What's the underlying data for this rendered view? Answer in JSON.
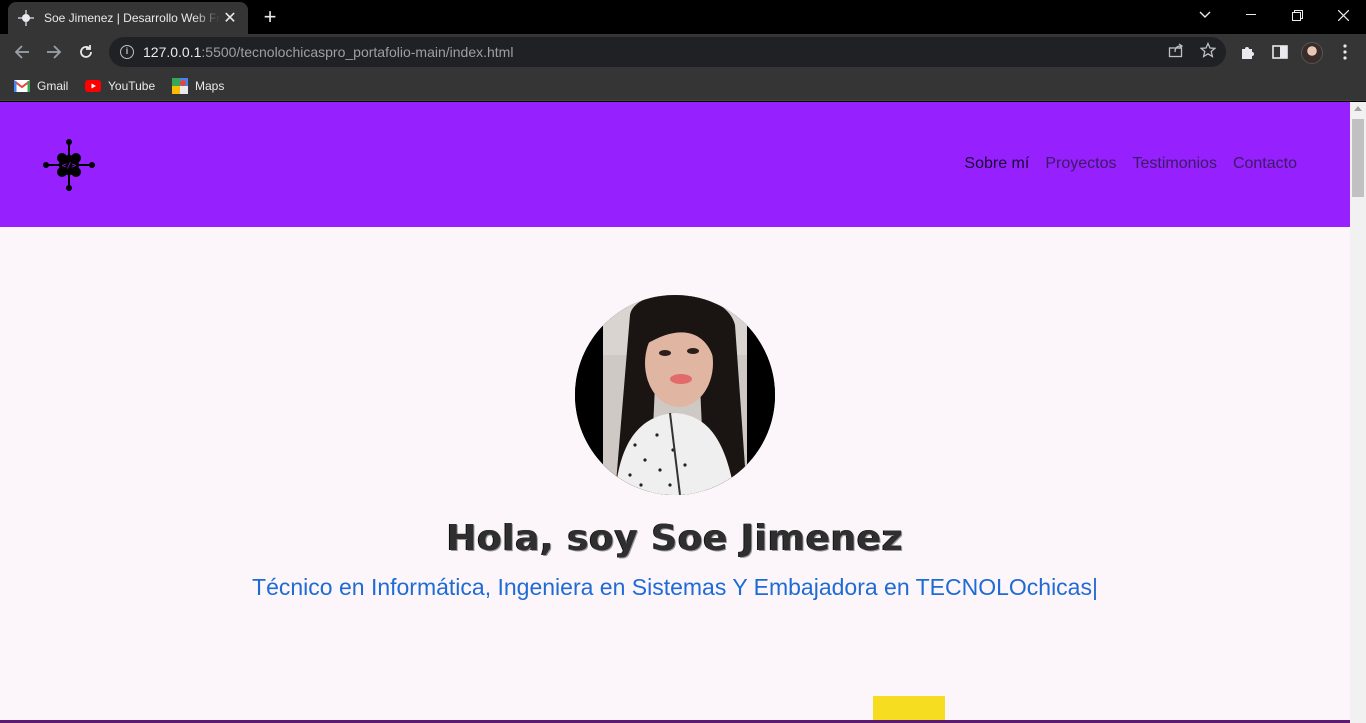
{
  "browser": {
    "tab": {
      "title": "Soe Jimenez | Desarrollo Web Front End",
      "favicon": "site-logo-icon"
    },
    "url": {
      "host": "127.0.0.1",
      "path": ":5500/tecnolochicaspro_portafolio-main/index.html"
    },
    "bookmarks": [
      {
        "label": "Gmail",
        "icon": "gmail-icon"
      },
      {
        "label": "YouTube",
        "icon": "youtube-icon"
      },
      {
        "label": "Maps",
        "icon": "maps-icon"
      }
    ]
  },
  "site": {
    "colors": {
      "header_bg": "#9621fe",
      "page_bg": "#fcf6fb",
      "subtitle": "#1f6bd6",
      "accent_yellow": "#f6dd1f"
    },
    "nav": [
      {
        "label": "Sobre mí",
        "active": true
      },
      {
        "label": "Proyectos"
      },
      {
        "label": "Testimonios"
      },
      {
        "label": "Contacto"
      }
    ],
    "hero": {
      "title": "Hola, soy Soe Jimenez",
      "subtitle": "Técnico en Informática, Ingeniera en Sistemas Y Embajadora en TECNOLOchicas|"
    }
  }
}
